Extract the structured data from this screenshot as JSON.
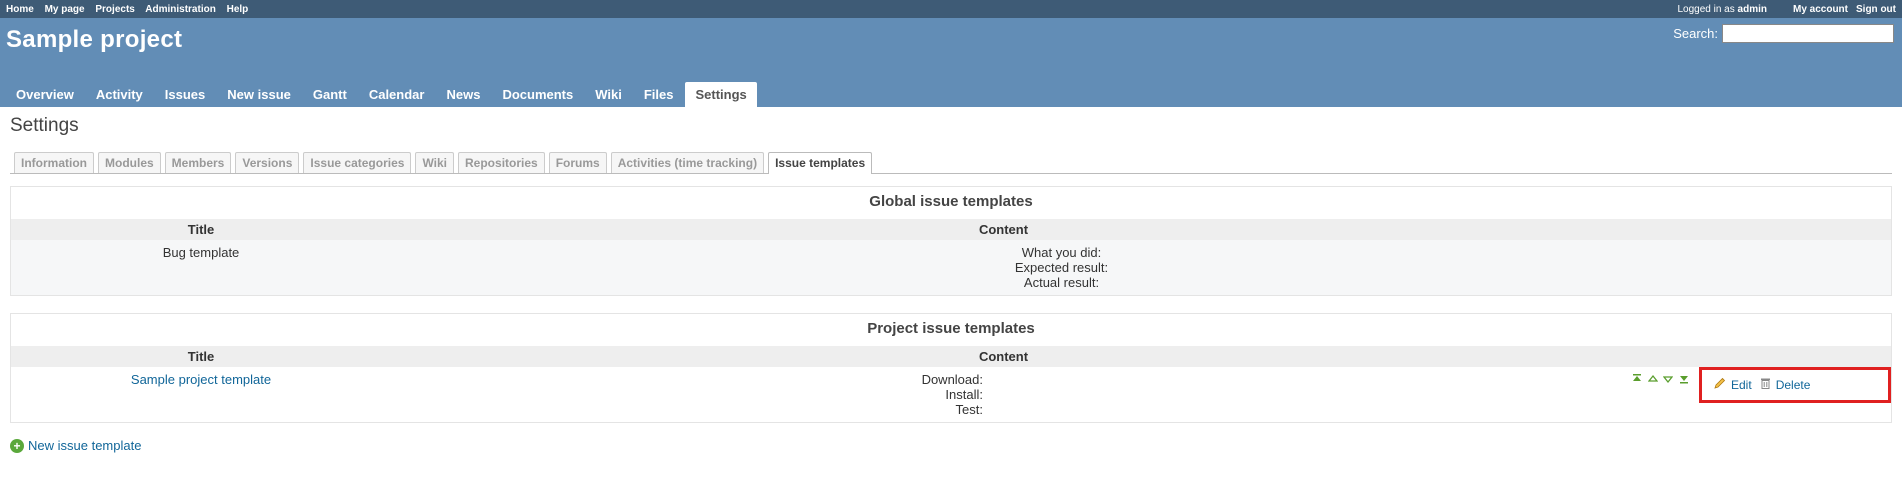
{
  "top_menu": {
    "links": [
      "Home",
      "My page",
      "Projects",
      "Administration",
      "Help"
    ],
    "logged_in_prefix": "Logged in as",
    "user": "admin",
    "my_account": "My account",
    "sign_out": "Sign out"
  },
  "header": {
    "project_title": "Sample project",
    "search_label": "Search:",
    "search_value": ""
  },
  "main_menu": {
    "tabs": [
      "Overview",
      "Activity",
      "Issues",
      "New issue",
      "Gantt",
      "Calendar",
      "News",
      "Documents",
      "Wiki",
      "Files",
      "Settings"
    ],
    "selected": "Settings"
  },
  "page": {
    "title": "Settings"
  },
  "settings_tabs": {
    "tabs": [
      "Information",
      "Modules",
      "Members",
      "Versions",
      "Issue categories",
      "Wiki",
      "Repositories",
      "Forums",
      "Activities (time tracking)",
      "Issue templates"
    ],
    "selected": "Issue templates"
  },
  "global_templates": {
    "heading": "Global issue templates",
    "col_title": "Title",
    "col_content": "Content",
    "rows": [
      {
        "title": "Bug template",
        "content_lines": [
          "What you did:",
          "Expected result:",
          "Actual result:"
        ]
      }
    ]
  },
  "project_templates": {
    "heading": "Project issue templates",
    "col_title": "Title",
    "col_content": "Content",
    "rows": [
      {
        "title": "Sample project template",
        "content_lines": [
          "Download:",
          "Install:",
          "Test:"
        ],
        "edit_label": "Edit",
        "delete_label": "Delete"
      }
    ]
  },
  "new_template_link": "New issue template",
  "colors": {
    "top_menu_bg": "#3e5b76",
    "header_bg": "#628db6",
    "link": "#169",
    "highlight_border": "#e02020",
    "reorder_green": "#5a9e2d"
  }
}
